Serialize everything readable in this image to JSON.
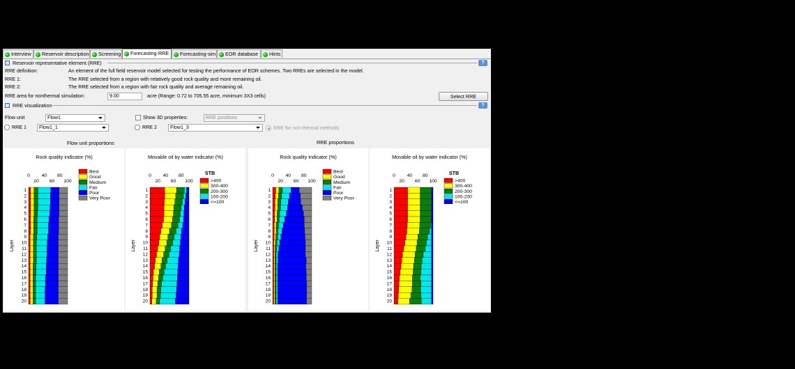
{
  "tabs": [
    {
      "label": "Interview",
      "active": false
    },
    {
      "label": "Reservoir description",
      "active": false
    },
    {
      "label": "Screening",
      "active": false
    },
    {
      "label": "Forecasting-RRE",
      "active": true
    },
    {
      "label": "Forecasting-sim",
      "active": false
    },
    {
      "label": "EOR database",
      "active": false
    },
    {
      "label": "Hints",
      "active": false
    }
  ],
  "rre_section": {
    "title": "Reservoir representative element (RRE)",
    "help": "?",
    "definition_label": "RRE definition:",
    "definition_text": "An element of the full field reservoir model selected for testing the performance of EOR schemes. Two RREs are selected in the model.",
    "rre1_label": "RRE 1:",
    "rre1_text": "The RRE selected from a region with relatively good rock quality and more remaining oil.",
    "rre2_label": "RRE 2:",
    "rre2_text": "The RRE selected from a region with fair rock quality and average remaining oil.",
    "area_label": "RRE area for nonthermal simulation:",
    "area_value": "9.00",
    "area_hint": "acre (Range: 0.72 to 705.55 acre, minimum 3X3 cells)",
    "select_button": "Select RRE"
  },
  "viz_section": {
    "title": "RRE visualization",
    "help": "?",
    "flow_unit_label": "Flow unit",
    "flow_unit_value": "Flow1",
    "show3d_label": "Show 3D properties:",
    "show3d_value": "RRE positions",
    "rre1_radio": "RRE 1",
    "rre1_value": "Flow1_1",
    "rre2_radio": "RRE 2",
    "rre2_value": "Flow1_3",
    "nonthermal_radio": "RRE for non-thermal methods",
    "group_left": "Flow unit proportions",
    "group_right": "RRE proportions"
  },
  "colors": {
    "Best": "#ff0000",
    "Good": "#ffff00",
    "Medium": "#0b7d0b",
    "Fair": "#00e8e8",
    "Poor": "#0000ff",
    "Very Poor": "#808080",
    ">400": "#ff0000",
    "300-400": "#ffff00",
    "200-300": "#0b7d0b",
    "100-200": "#00e8e8",
    "<=100": "#0000ff"
  },
  "chart_data": [
    {
      "type": "bar",
      "orientation": "horizontal",
      "stacked": true,
      "title": "Rock quality indicator (%)",
      "ylabel": "Layer",
      "xlim": [
        0,
        100
      ],
      "xticks": [
        "0",
        "20",
        "40",
        "60",
        "80",
        "100"
      ],
      "legend_title": "",
      "categories": [
        "1",
        "2",
        "3",
        "4",
        "5",
        "6",
        "7",
        "8",
        "9",
        "10",
        "11",
        "12",
        "13",
        "14",
        "15",
        "16",
        "17",
        "18",
        "19",
        "20"
      ],
      "series": [
        {
          "name": "Best",
          "values": [
            5,
            5,
            5,
            5,
            5,
            5,
            5,
            5,
            4,
            4,
            4,
            4,
            4,
            4,
            4,
            4,
            4,
            4,
            4,
            4
          ]
        },
        {
          "name": "Good",
          "values": [
            9,
            9,
            9,
            9,
            9,
            8,
            8,
            8,
            8,
            8,
            8,
            8,
            8,
            7,
            7,
            7,
            7,
            7,
            7,
            7
          ]
        },
        {
          "name": "Medium",
          "values": [
            10,
            10,
            10,
            10,
            9,
            9,
            9,
            9,
            9,
            8,
            8,
            8,
            8,
            8,
            8,
            7,
            7,
            7,
            7,
            7
          ]
        },
        {
          "name": "Fair",
          "values": [
            33,
            32,
            32,
            31,
            31,
            30,
            29,
            29,
            28,
            28,
            27,
            27,
            26,
            26,
            26,
            25,
            25,
            24,
            24,
            24
          ]
        },
        {
          "name": "Poor",
          "values": [
            21,
            22,
            22,
            23,
            24,
            25,
            26,
            26,
            27,
            28,
            29,
            29,
            30,
            31,
            31,
            33,
            33,
            34,
            34,
            34
          ]
        },
        {
          "name": "Very Poor",
          "values": [
            22,
            22,
            22,
            22,
            22,
            23,
            23,
            23,
            24,
            24,
            24,
            24,
            24,
            24,
            24,
            24,
            24,
            24,
            24,
            24
          ]
        }
      ]
    },
    {
      "type": "bar",
      "orientation": "horizontal",
      "stacked": true,
      "title": "Movable oil by water indicator (%)",
      "ylabel": "Layer",
      "xlim": [
        0,
        100
      ],
      "xticks": [
        "0",
        "20",
        "40",
        "60",
        "80",
        "100"
      ],
      "legend_title": "STB",
      "categories": [
        "1",
        "2",
        "3",
        "4",
        "5",
        "6",
        "7",
        "8",
        "9",
        "10",
        "11",
        "12",
        "13",
        "14",
        "15",
        "16",
        "17",
        "18",
        "19",
        "20"
      ],
      "series": [
        {
          "name": ">400",
          "values": [
            38,
            38,
            37,
            36,
            36,
            35,
            32,
            28,
            25,
            23,
            20,
            17,
            14,
            12,
            9,
            8,
            7,
            6,
            6,
            5
          ]
        },
        {
          "name": "300-400",
          "values": [
            30,
            28,
            27,
            25,
            24,
            23,
            23,
            22,
            21,
            20,
            19,
            18,
            17,
            16,
            15,
            14,
            13,
            12,
            12,
            11
          ]
        },
        {
          "name": "200-300",
          "values": [
            20,
            20,
            19,
            19,
            18,
            18,
            17,
            17,
            16,
            15,
            14,
            14,
            13,
            12,
            12,
            11,
            10,
            10,
            9,
            9
          ]
        },
        {
          "name": "100-200",
          "values": [
            6,
            6,
            7,
            8,
            9,
            10,
            12,
            14,
            17,
            20,
            23,
            26,
            29,
            32,
            35,
            37,
            39,
            40,
            40,
            40
          ]
        },
        {
          "name": "<=100",
          "values": [
            6,
            8,
            10,
            12,
            13,
            14,
            16,
            19,
            21,
            22,
            24,
            25,
            27,
            28,
            29,
            30,
            31,
            32,
            33,
            35
          ]
        }
      ]
    },
    {
      "type": "bar",
      "orientation": "horizontal",
      "stacked": true,
      "title": "Rock quality indicator (%)",
      "ylabel": "Layer",
      "xlim": [
        0,
        100
      ],
      "xticks": [
        "0",
        "20",
        "40",
        "60",
        "80",
        "100"
      ],
      "legend_title": "",
      "categories": [
        "1",
        "2",
        "3",
        "4",
        "5",
        "6",
        "7",
        "8",
        "9",
        "10",
        "11",
        "12",
        "13",
        "14",
        "15",
        "16",
        "17",
        "18",
        "19",
        "20"
      ],
      "series": [
        {
          "name": "Best",
          "values": [
            8,
            7,
            6,
            6,
            5,
            5,
            4,
            4,
            4,
            3,
            3,
            3,
            3,
            3,
            3,
            3,
            3,
            3,
            3,
            3
          ]
        },
        {
          "name": "Good",
          "values": [
            8,
            8,
            7,
            7,
            6,
            6,
            5,
            5,
            4,
            4,
            3,
            3,
            3,
            3,
            3,
            3,
            3,
            3,
            3,
            3
          ]
        },
        {
          "name": "Medium",
          "values": [
            9,
            8,
            8,
            7,
            7,
            6,
            6,
            5,
            5,
            4,
            4,
            3,
            3,
            3,
            3,
            3,
            3,
            3,
            3,
            3
          ]
        },
        {
          "name": "Fair",
          "values": [
            22,
            20,
            19,
            18,
            17,
            14,
            12,
            10,
            8,
            7,
            6,
            5,
            5,
            4,
            4,
            4,
            4,
            4,
            4,
            4
          ]
        },
        {
          "name": "Poor",
          "values": [
            21,
            28,
            32,
            38,
            44,
            50,
            54,
            58,
            62,
            66,
            68,
            70,
            72,
            72,
            73,
            73,
            74,
            74,
            74,
            74
          ]
        },
        {
          "name": "Very Poor",
          "values": [
            32,
            29,
            28,
            24,
            21,
            19,
            19,
            18,
            17,
            16,
            16,
            16,
            14,
            15,
            14,
            14,
            13,
            13,
            13,
            13
          ]
        }
      ]
    },
    {
      "type": "bar",
      "orientation": "horizontal",
      "stacked": true,
      "title": "Movable oil by water indicator (%)",
      "ylabel": "Layer",
      "xlim": [
        0,
        100
      ],
      "xticks": [
        "0",
        "20",
        "40",
        "60",
        "80",
        "100"
      ],
      "legend_title": "STB",
      "categories": [
        "1",
        "2",
        "3",
        "4",
        "5",
        "6",
        "7",
        "8",
        "9",
        "10",
        "11",
        "12",
        "13",
        "14",
        "15",
        "16",
        "17",
        "18",
        "19",
        "20"
      ],
      "series": [
        {
          "name": ">400",
          "values": [
            35,
            35,
            35,
            35,
            35,
            35,
            34,
            33,
            31,
            28,
            25,
            22,
            20,
            18,
            16,
            14,
            13,
            12,
            11,
            10
          ]
        },
        {
          "name": "300-400",
          "values": [
            32,
            32,
            32,
            32,
            32,
            32,
            32,
            32,
            30,
            31,
            32,
            32,
            32,
            32,
            33,
            33,
            34,
            34,
            32,
            30
          ]
        },
        {
          "name": "200-300",
          "values": [
            29,
            29,
            29,
            29,
            29,
            28,
            28,
            26,
            25,
            24,
            23,
            21,
            20,
            20,
            20,
            20,
            22,
            22,
            26,
            30
          ]
        },
        {
          "name": "100-200",
          "values": [
            0,
            0,
            0,
            0,
            0,
            1,
            2,
            5,
            10,
            13,
            16,
            21,
            24,
            26,
            27,
            29,
            27,
            28,
            27,
            26
          ]
        },
        {
          "name": "<=100",
          "values": [
            4,
            4,
            4,
            4,
            4,
            4,
            4,
            4,
            4,
            4,
            4,
            4,
            4,
            4,
            4,
            4,
            4,
            4,
            4,
            4
          ]
        }
      ]
    }
  ]
}
